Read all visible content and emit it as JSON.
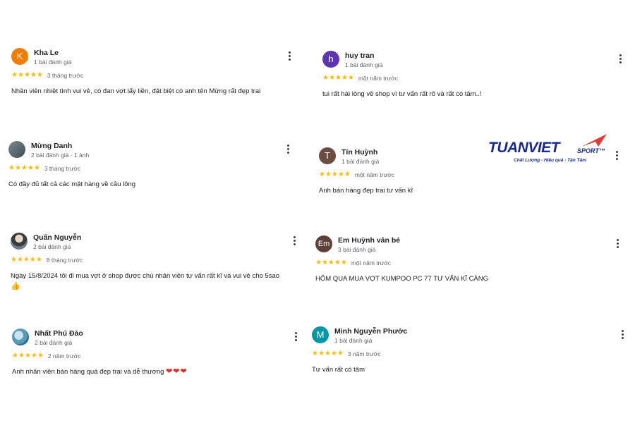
{
  "reviews_left": [
    {
      "name": "Kha Le",
      "sub": "1 bài đánh giá",
      "avatar": {
        "letter": "K",
        "color": "#f57c00"
      },
      "stars": "★★★★★",
      "date": "3 tháng trước",
      "text": "Nhân viên nhiệt tình vui vẻ, có đan vợt lấy liền, đặt biệt có anh tên Mừng rất đẹp trai"
    },
    {
      "name": "Mừng Danh",
      "sub": "2 bài đánh giá · 1 ảnh",
      "avatar": {
        "letter": "",
        "color": "#5f6b73"
      },
      "stars": "★★★★★",
      "date": "3 tháng trước",
      "text": "Có đầy đủ tất cả các mặt hàng về cầu lông"
    },
    {
      "name": "Quấn Nguyễn",
      "sub": "2 bài đánh giá",
      "avatar": {
        "letter": "",
        "color": "#6b7b88"
      },
      "stars": "★★★★★",
      "date": "8 tháng trước",
      "text": "Ngày 15/8/2024 tôi đi mua vợt ở shop được chú nhân viên tư vấn rất kĩ và vui vẻ cho 5sao",
      "emoji": "👍"
    },
    {
      "name": "Nhất Phú Đào",
      "sub": "2 bài đánh giá",
      "avatar": {
        "letter": "",
        "color": "#5a9ab8"
      },
      "stars": "★★★★★",
      "date": "2 năm trước",
      "text": "Anh nhân viên bán hàng quá đẹp trai và dễ thương",
      "emoji": "❤❤❤"
    }
  ],
  "reviews_right": [
    {
      "name": "huy tran",
      "sub": "1 bài đánh giá",
      "avatar": {
        "letter": "h",
        "color": "#5e35b1"
      },
      "stars": "★★★★★",
      "date": "một năm trước",
      "text": "tui rất hài lòng về shop vì tư vấn rất rõ và rất có tâm..!"
    },
    {
      "name": "Tín Huỳnh",
      "sub": "1 bài đánh giá",
      "avatar": {
        "letter": "T",
        "color": "#6d4c41"
      },
      "stars": "★★★★★",
      "date": "một năm trước",
      "text": "Anh bán hàng đẹp trai tư vấn kĩ"
    },
    {
      "name": "Em Huỳnh văn bé",
      "sub": "3 bài đánh giá",
      "avatar": {
        "letter": "Em",
        "color": "#5d4037"
      },
      "stars": "★★★★★",
      "date": "một năm trước",
      "text": "HÔM QUA MUA VỢT KUMPOO PC 77 TƯ VẤN KĨ CÀNG"
    },
    {
      "name": "Minh Nguyễn Phước",
      "sub": "1 bài đánh giá",
      "avatar": {
        "letter": "M",
        "color": "#0097a7"
      },
      "stars": "★★★★★",
      "date": "3 năm trước",
      "text": "Tư vấn rất có tâm"
    }
  ],
  "logo": {
    "main": "TUANVIET",
    "sport": "SPORT™",
    "tagline": "Chất Lượng - Hiệu quả - Tận Tâm",
    "color": "#1a2a8c",
    "accent": "#e53935"
  }
}
